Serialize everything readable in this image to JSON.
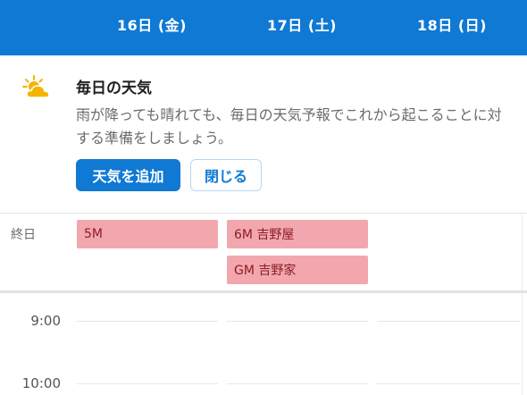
{
  "header": {
    "days": [
      "16日 (金)",
      "17日 (土)",
      "18日 (日)"
    ],
    "background": "#0F79D4"
  },
  "weather_card": {
    "icon": "partly-cloudy-icon",
    "title": "毎日の天気",
    "body": "雨が降っても晴れても、毎日の天気予報でこれから起こることに対する準備をしましょう。",
    "add_button": "天気を追加",
    "close_button": "閉じる"
  },
  "all_day": {
    "label": "終日",
    "events": [
      {
        "day": 0,
        "title": "5M"
      },
      {
        "day": 1,
        "title": "6M 吉野屋"
      },
      {
        "day": 1,
        "title": "GM 吉野家"
      }
    ],
    "event_color": "#F2A7AE"
  },
  "timeline": {
    "times": [
      "9:00",
      "10:00"
    ]
  }
}
